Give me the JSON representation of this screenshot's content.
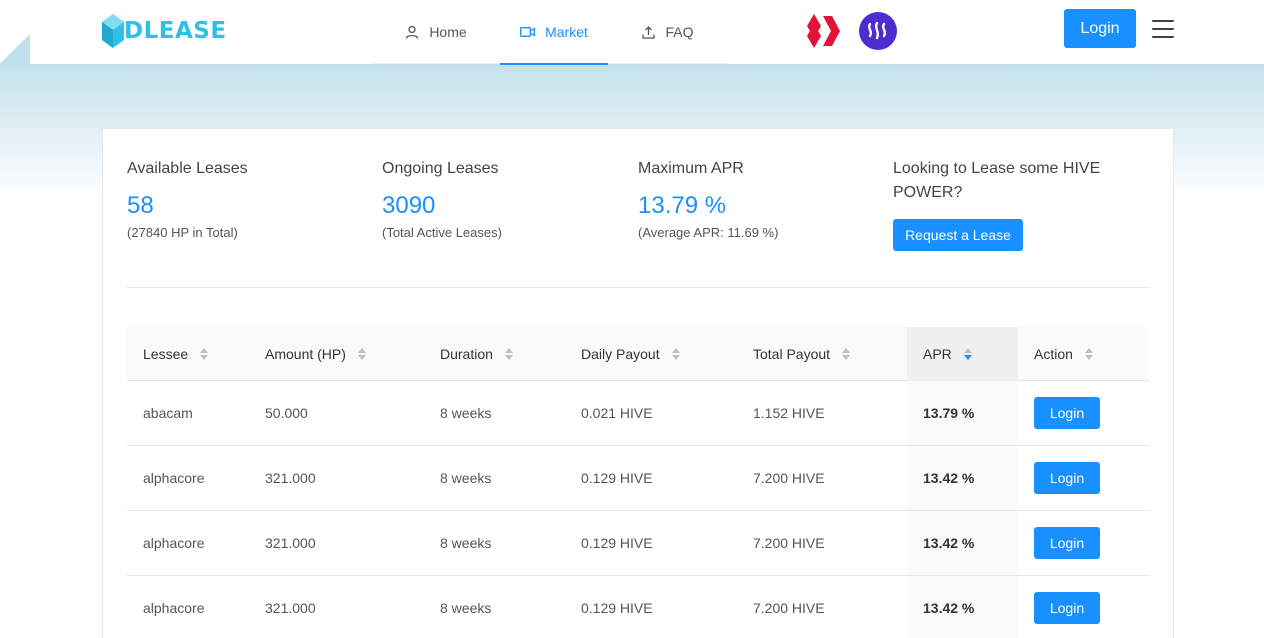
{
  "brand": {
    "name": "DLEASE",
    "color": "#2dc1e6"
  },
  "nav": {
    "items": [
      {
        "label": "Home",
        "icon": "user-icon"
      },
      {
        "label": "Market",
        "icon": "video-icon",
        "active": true
      },
      {
        "label": "FAQ",
        "icon": "upload-icon"
      }
    ]
  },
  "chains": [
    {
      "name": "hive-logo",
      "color": "#e31337"
    },
    {
      "name": "steem-logo",
      "color": "#4b2dd0"
    }
  ],
  "header": {
    "login_label": "Login",
    "menu_icon": "hamburger-menu-icon"
  },
  "stats": {
    "available": {
      "title": "Available Leases",
      "value": "58",
      "sub": "(27840 HP in Total)"
    },
    "ongoing": {
      "title": "Ongoing Leases",
      "value": "3090",
      "sub": "(Total Active Leases)"
    },
    "max_apr": {
      "title": "Maximum APR",
      "value": "13.79 %",
      "sub": "(Average APR: 11.69 %)"
    },
    "request": {
      "title": "Looking to Lease some HIVE POWER?",
      "button_label": "Request a Lease"
    }
  },
  "table": {
    "columns": [
      "Lessee",
      "Amount (HP)",
      "Duration",
      "Daily Payout",
      "Total Payout",
      "APR",
      "Action"
    ],
    "sorted_column": "APR",
    "rows": [
      {
        "lessee": "abacam",
        "amount": "50.000",
        "duration": "8 weeks",
        "daily": "0.021 HIVE",
        "total": "1.152 HIVE",
        "apr": "13.79 %",
        "action": "Login"
      },
      {
        "lessee": "alphacore",
        "amount": "321.000",
        "duration": "8 weeks",
        "daily": "0.129 HIVE",
        "total": "7.200 HIVE",
        "apr": "13.42 %",
        "action": "Login"
      },
      {
        "lessee": "alphacore",
        "amount": "321.000",
        "duration": "8 weeks",
        "daily": "0.129 HIVE",
        "total": "7.200 HIVE",
        "apr": "13.42 %",
        "action": "Login"
      },
      {
        "lessee": "alphacore",
        "amount": "321.000",
        "duration": "8 weeks",
        "daily": "0.129 HIVE",
        "total": "7.200 HIVE",
        "apr": "13.42 %",
        "action": "Login"
      }
    ]
  },
  "colors": {
    "accent": "#1890ff"
  }
}
